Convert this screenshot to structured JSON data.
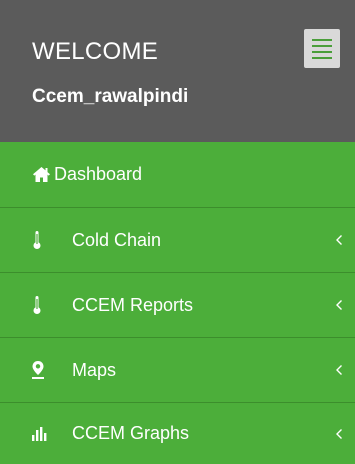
{
  "header": {
    "welcome": "WELCOME",
    "username": "Ccem_rawalpindi"
  },
  "colors": {
    "header_bg": "#5b5b5b",
    "nav_bg": "#4cae3a",
    "nav_divider": "#3c8e2c",
    "text": "#ffffff",
    "toggle_bg": "#d9d9d9"
  },
  "nav": {
    "items": [
      {
        "label": "Dashboard",
        "icon": "home-icon",
        "has_submenu": false
      },
      {
        "label": "Cold Chain",
        "icon": "thermometer-icon",
        "has_submenu": true
      },
      {
        "label": "CCEM Reports",
        "icon": "thermometer-icon",
        "has_submenu": true
      },
      {
        "label": "Maps",
        "icon": "map-marker-icon",
        "has_submenu": true
      },
      {
        "label": "CCEM Graphs",
        "icon": "bar-chart-icon",
        "has_submenu": true
      }
    ]
  }
}
